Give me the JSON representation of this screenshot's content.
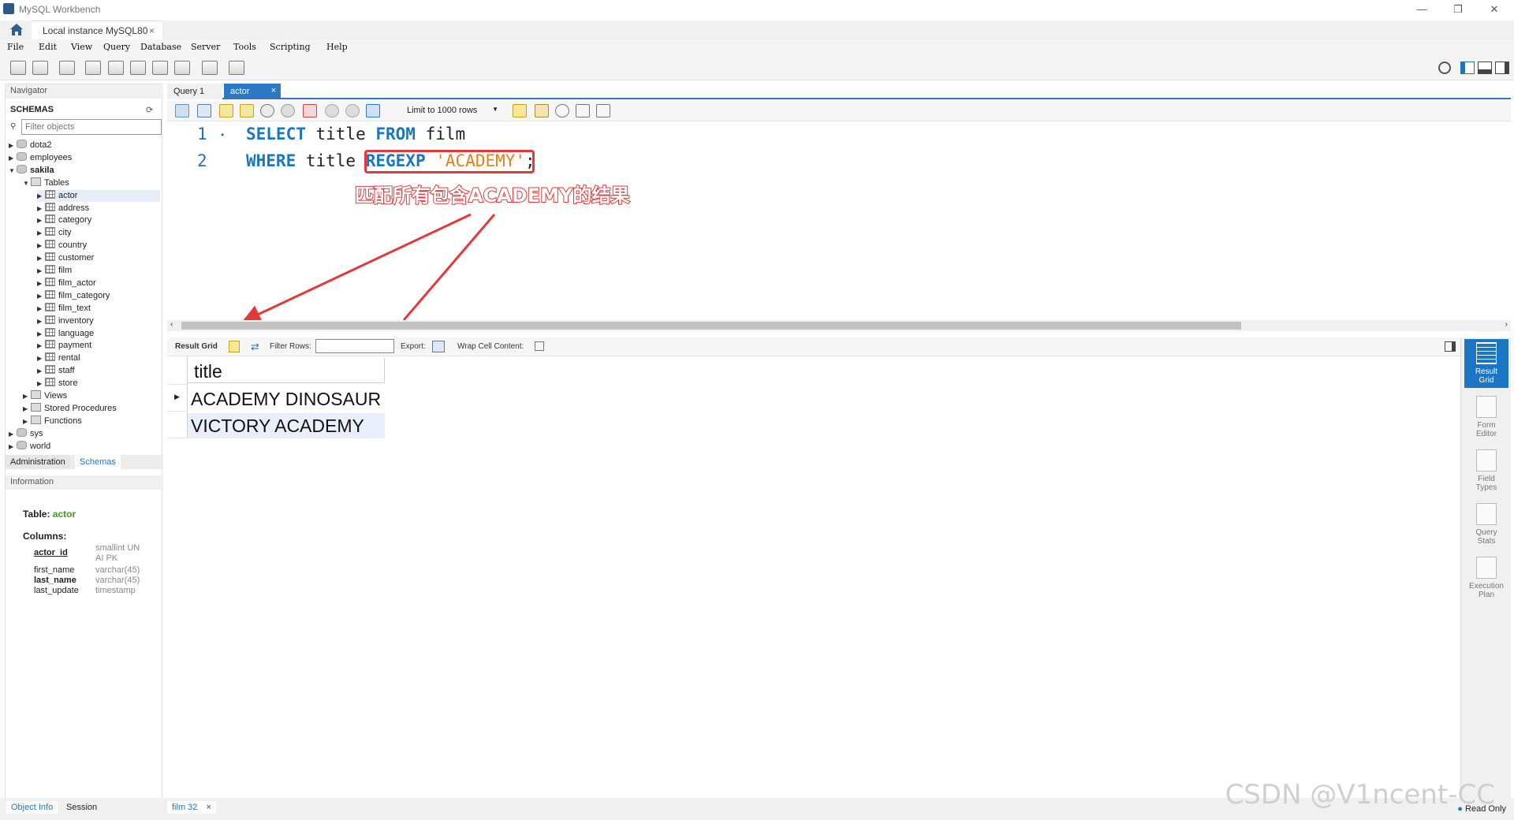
{
  "window": {
    "title": "MySQL Workbench",
    "minimize": "—",
    "restore": "❐",
    "close": "✕"
  },
  "connection_tab": {
    "label": "Local instance MySQL80",
    "close": "×"
  },
  "menu": [
    "File",
    "Edit",
    "View",
    "Query",
    "Database",
    "Server",
    "Tools",
    "Scripting",
    "Help"
  ],
  "navigator": {
    "header": "Navigator",
    "schemas_label": "SCHEMAS",
    "filter_placeholder": "Filter objects",
    "tree": [
      {
        "label": "dota2",
        "level": 0,
        "arrow": "▶",
        "icon": "db"
      },
      {
        "label": "employees",
        "level": 0,
        "arrow": "▶",
        "icon": "db"
      },
      {
        "label": "sakila",
        "level": 0,
        "arrow": "▼",
        "icon": "db",
        "bold": true
      },
      {
        "label": "Tables",
        "level": 1,
        "arrow": "▼",
        "icon": "folder"
      },
      {
        "label": "actor",
        "level": 2,
        "arrow": "▶",
        "icon": "table",
        "selected": true
      },
      {
        "label": "address",
        "level": 2,
        "arrow": "▶",
        "icon": "table"
      },
      {
        "label": "category",
        "level": 2,
        "arrow": "▶",
        "icon": "table"
      },
      {
        "label": "city",
        "level": 2,
        "arrow": "▶",
        "icon": "table"
      },
      {
        "label": "country",
        "level": 2,
        "arrow": "▶",
        "icon": "table"
      },
      {
        "label": "customer",
        "level": 2,
        "arrow": "▶",
        "icon": "table"
      },
      {
        "label": "film",
        "level": 2,
        "arrow": "▶",
        "icon": "table"
      },
      {
        "label": "film_actor",
        "level": 2,
        "arrow": "▶",
        "icon": "table"
      },
      {
        "label": "film_category",
        "level": 2,
        "arrow": "▶",
        "icon": "table"
      },
      {
        "label": "film_text",
        "level": 2,
        "arrow": "▶",
        "icon": "table"
      },
      {
        "label": "inventory",
        "level": 2,
        "arrow": "▶",
        "icon": "table"
      },
      {
        "label": "language",
        "level": 2,
        "arrow": "▶",
        "icon": "table"
      },
      {
        "label": "payment",
        "level": 2,
        "arrow": "▶",
        "icon": "table"
      },
      {
        "label": "rental",
        "level": 2,
        "arrow": "▶",
        "icon": "table"
      },
      {
        "label": "staff",
        "level": 2,
        "arrow": "▶",
        "icon": "table"
      },
      {
        "label": "store",
        "level": 2,
        "arrow": "▶",
        "icon": "table"
      },
      {
        "label": "Views",
        "level": 1,
        "arrow": "▶",
        "icon": "folder"
      },
      {
        "label": "Stored Procedures",
        "level": 1,
        "arrow": "▶",
        "icon": "folder"
      },
      {
        "label": "Functions",
        "level": 1,
        "arrow": "▶",
        "icon": "folder"
      },
      {
        "label": "sys",
        "level": 0,
        "arrow": "▶",
        "icon": "db"
      },
      {
        "label": "world",
        "level": 0,
        "arrow": "▶",
        "icon": "db"
      }
    ],
    "tabs": {
      "administration": "Administration",
      "schemas": "Schemas"
    },
    "info_header": "Information",
    "info": {
      "table_label": "Table:",
      "table_name": "actor",
      "columns_label": "Columns:",
      "columns": [
        {
          "name": "actor_id",
          "type": "smallint UN",
          "type2": "AI PK"
        },
        {
          "name": "first_name",
          "type": "varchar(45)"
        },
        {
          "name": "last_name",
          "type": "varchar(45)"
        },
        {
          "name": "last_update",
          "type": "timestamp"
        }
      ]
    },
    "bottom_tabs": {
      "object_info": "Object Info",
      "session": "Session"
    }
  },
  "editor": {
    "tabs": {
      "query1": "Query 1",
      "actor": "actor",
      "close": "×"
    },
    "limit_label": "Limit to 1000 rows",
    "lines": [
      {
        "num": "1",
        "dot": "•",
        "kw1": "SELECT",
        "t1": " title ",
        "kw2": "FROM",
        "t2": " film"
      },
      {
        "num": "2",
        "kw1": "WHERE",
        "t1": " title ",
        "kw2": "REGEXP",
        "str": "'ACADEMY'",
        "end": ";"
      }
    ],
    "annotation": "匹配所有包含ACADEMY的结果"
  },
  "result": {
    "toolbar": {
      "result_grid": "Result Grid",
      "filter_rows": "Filter Rows:",
      "export": "Export:",
      "wrap": "Wrap Cell Content:"
    },
    "column": "title",
    "rows": [
      "ACADEMY DINOSAUR",
      "VICTORY ACADEMY"
    ]
  },
  "side_panel": [
    {
      "label1": "Result",
      "label2": "Grid",
      "active": true
    },
    {
      "label1": "Form",
      "label2": "Editor"
    },
    {
      "label1": "Field",
      "label2": "Types"
    },
    {
      "label1": "Query",
      "label2": "Stats"
    },
    {
      "label1": "Execution",
      "label2": "Plan"
    }
  ],
  "bottom": {
    "result_tab": "film 32",
    "close": "×",
    "read_only": "Read Only"
  },
  "watermark": "CSDN @V1ncent-CC",
  "colors": {
    "accent": "#1b76c4",
    "keyword": "#1a78c2",
    "string": "#e0811f",
    "annotation": "#e23a3a"
  }
}
